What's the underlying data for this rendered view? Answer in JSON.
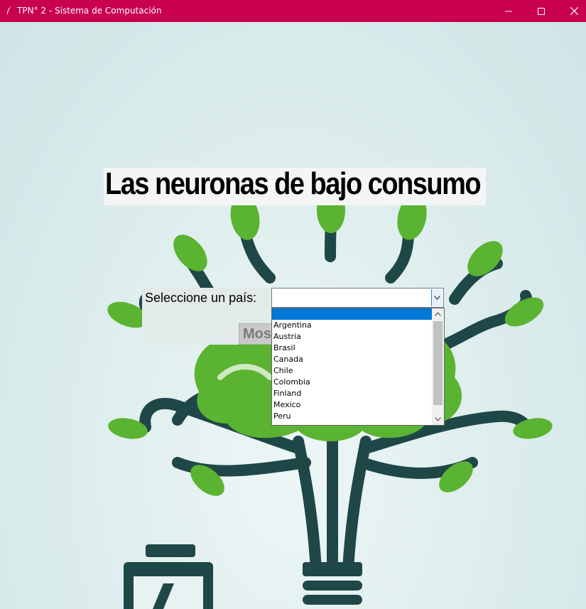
{
  "window": {
    "title": "TPN° 2 - Sistema de Computación",
    "controls": [
      "minimize-icon",
      "maximize-icon",
      "close-icon"
    ]
  },
  "headline": "Las neuronas de bajo consumo",
  "form": {
    "country_label": "Seleccione un país:",
    "country_value": "",
    "show_button_label": "Mostrar"
  },
  "dropdown": {
    "options": [
      "",
      "Argentina",
      "Austria",
      "Brasil",
      "Canada",
      "Chile",
      "Colombia",
      "Finland",
      "Mexico",
      "Peru"
    ],
    "selected_index": 0
  },
  "colors": {
    "titlebar": "#c8004f",
    "selection": "#0078d7",
    "tree_dark": "#1f4747",
    "leaf": "#5bb332"
  }
}
